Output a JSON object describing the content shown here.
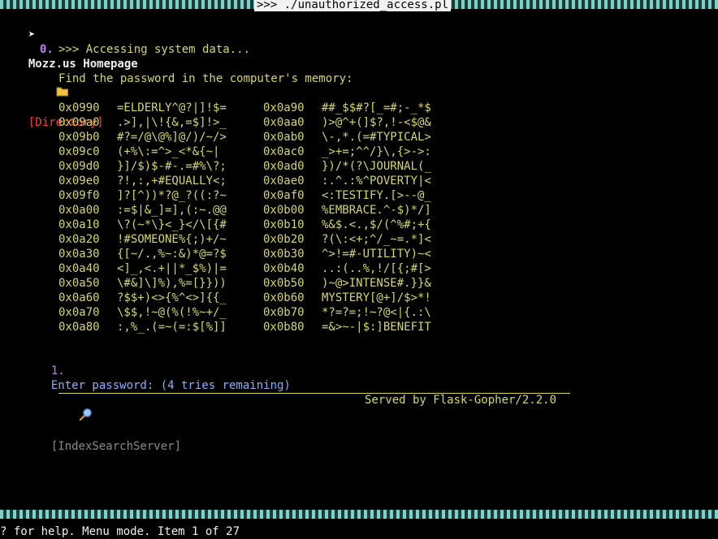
{
  "window": {
    "title": ">>> ./unauthorized_access.pl"
  },
  "menu": {
    "cursor": "➤",
    "item0": {
      "number": "0.",
      "label": "Mozz.us Homepage",
      "icon": "folder-icon",
      "type": "[Directory]"
    },
    "item1": {
      "number": "1.",
      "label": "Enter password: (4 tries remaining)",
      "icon": "magnifier-icon",
      "type": "[IndexSearchServer]"
    }
  },
  "content": {
    "accessing": ">>> Accessing system data...",
    "prompt": "Find the password in the computer's memory:",
    "memory_rows": [
      {
        "addr1": "0x0990",
        "data1": "=ELDERLY^@?|]!$=",
        "addr2": "0x0a90",
        "data2": "##_$$#?[_=#;-_*$"
      },
      {
        "addr1": "0x09a0",
        "data1": ".>],|\\!{&,=$]!>_",
        "addr2": "0x0aa0",
        "data2": ")>@^+(]$?,!-<$@&"
      },
      {
        "addr1": "0x09b0",
        "data1": "#?=/@\\@%]@/)/~/>",
        "addr2": "0x0ab0",
        "data2": "\\-,*.(=#TYPICAL>"
      },
      {
        "addr1": "0x09c0",
        "data1": "(+%\\:=^>_<*&{~|",
        "addr2": "0x0ac0",
        "data2": "_>+=;^^/}\\,{>->:"
      },
      {
        "addr1": "0x09d0",
        "data1": "}]/$)$-#-.=#%\\?;",
        "addr2": "0x0ad0",
        "data2": "})/*(?\\JOURNAL(_"
      },
      {
        "addr1": "0x09e0",
        "data1": "?!,:,+#EQUALLY<;",
        "addr2": "0x0ae0",
        "data2": ":.^.:%^POVERTY|<"
      },
      {
        "addr1": "0x09f0",
        "data1": "]?[^))*?@_?((:?~",
        "addr2": "0x0af0",
        "data2": "<:TESTIFY.[>--@_"
      },
      {
        "addr1": "0x0a00",
        "data1": ":=$|&_]=],(:~.@@",
        "addr2": "0x0b00",
        "data2": "%EMBRACE.^-$)*/]"
      },
      {
        "addr1": "0x0a10",
        "data1": "\\?(~*\\}<_}</\\[{#",
        "addr2": "0x0b10",
        "data2": "%&$.<.,$/(^%#;+{"
      },
      {
        "addr1": "0x0a20",
        "data1": "!#SOMEONE%{;)+/~",
        "addr2": "0x0b20",
        "data2": "?(\\:<+;^/_~=.*]<"
      },
      {
        "addr1": "0x0a30",
        "data1": "{[~/.,%~:&)*@=?$",
        "addr2": "0x0b30",
        "data2": "^>!=#-UTILITY)~<"
      },
      {
        "addr1": "0x0a40",
        "data1": "<]_,<.+||*_$%)|=",
        "addr2": "0x0b40",
        "data2": "..:(..%,!/[{;#[>"
      },
      {
        "addr1": "0x0a50",
        "data1": "\\#&]\\]%),%=[}}))",
        "addr2": "0x0b50",
        "data2": ")~@>INTENSE#.}}&"
      },
      {
        "addr1": "0x0a60",
        "data1": "?$$+)<>{%^<>]{{_",
        "addr2": "0x0b60",
        "data2": "MYSTERY[@+]/$>*!"
      },
      {
        "addr1": "0x0a70",
        "data1": "\\$$,!~@(%(!%~+/_",
        "addr2": "0x0b70",
        "data2": "*?=?=;!~?@<|{.:\\"
      },
      {
        "addr1": "0x0a80",
        "data1": ":,%_.(=~(=:$[%]]",
        "addr2": "0x0b80",
        "data2": "=&>~-|$:]BENEFIT"
      }
    ],
    "served_by": "Served by Flask-Gopher/2.2.0"
  },
  "status": {
    "text": "? for help. Menu mode. Item 1 of 27"
  },
  "colors": {
    "yellow": "#d7d75f",
    "red": "#ff3b3b",
    "magenta": "#c77dff",
    "blue": "#87afff"
  }
}
